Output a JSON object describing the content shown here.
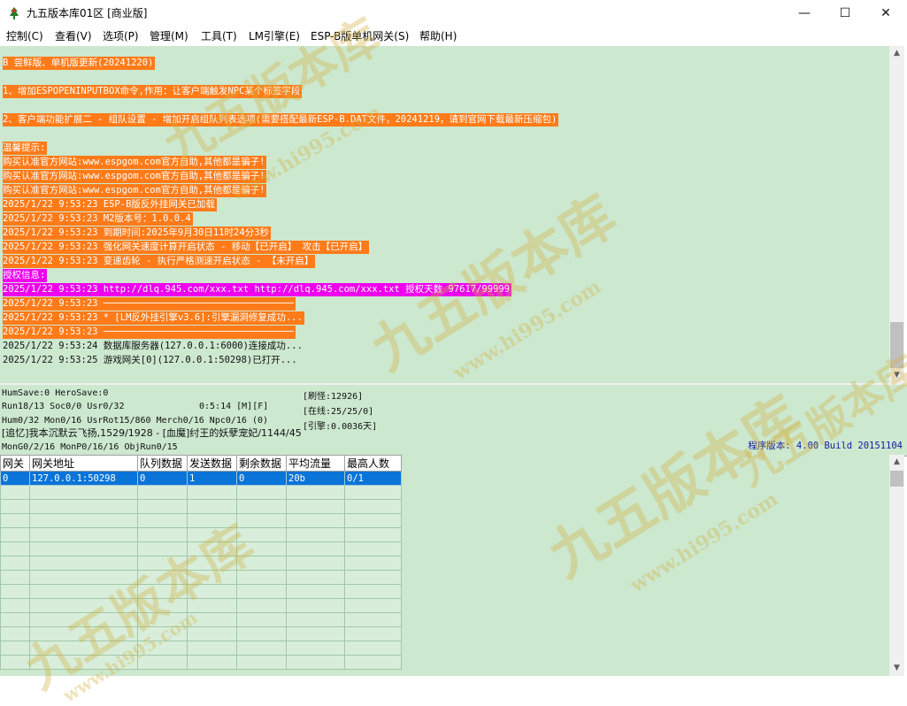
{
  "window": {
    "title": "九五版本库01区 [商业版]",
    "minimize": "—",
    "maximize": "☐",
    "close": "✕"
  },
  "menu": [
    "控制(C)",
    "查看(V)",
    "选项(P)",
    "管理(M)",
    "工具(T)",
    "LM引擎(E)",
    "ESP-B版单机网关(S)",
    "帮助(H)"
  ],
  "log": [
    {
      "text": "B 尝鲜版、单机版更新(20241220)",
      "style": "orange"
    },
    {
      "text": "1、增加ESPOPENINPUTBOX命令,作用：让客户端触发NPC某个标签字段",
      "style": "orange"
    },
    {
      "text": "2、客户端功能扩展二 - 组队设置 - 增加开启组队列表选项(需要搭配最新ESP-B.DAT文件，20241219，请到官网下载最新压缩包)",
      "style": "orange"
    },
    {
      "text": "温馨提示:",
      "style": "orange"
    },
    {
      "text": "购买认准官方网站:www.espgom.com官方自助,其他都是骗子!",
      "style": "orange"
    },
    {
      "text": "购买认准官方网站:www.espgom.com官方自助,其他都是骗子!",
      "style": "orange"
    },
    {
      "text": "购买认准官方网站:www.espgom.com官方自助,其他都是骗子!",
      "style": "orange"
    },
    {
      "text": "2025/1/22 9:53:23 ESP-B版反外挂网关已加载",
      "style": "orange"
    },
    {
      "text": "2025/1/22 9:53:23 M2版本号：1.0.0.4",
      "style": "orange"
    },
    {
      "text": "2025/1/22 9:53:23 到期时间:2025年9月30日11时24分3秒",
      "style": "orange"
    },
    {
      "text": "2025/1/22 9:53:23 强化网关速度计算开启状态 - 移动【已开启】 攻击【已开启】",
      "style": "orange"
    },
    {
      "text": "2025/1/22 9:53:23 变速齿轮 - 执行严格测速开启状态 - 【未开启】",
      "style": "orange"
    },
    {
      "text": "授权信息:",
      "style": "magenta"
    },
    {
      "text": "2025/1/22 9:53:23 http://dlq.945.com/xxx.txt http://dlq.945.com/xxx.txt 授权天数 97617/99999",
      "style": "magenta"
    },
    {
      "text": "2025/1/22 9:53:23 ──────────────────────────────────",
      "style": "orange"
    },
    {
      "text": "2025/1/22 9:53:23 * [LM反外挂引擎v3.6]:引擎漏洞修复成功...",
      "style": "orange"
    },
    {
      "text": "2025/1/22 9:53:23 ──────────────────────────────────",
      "style": "orange"
    },
    {
      "text": "2025/1/22 9:53:24 数据库服务器(127.0.0.1:6000)连接成功...",
      "style": "plain"
    },
    {
      "text": "2025/1/22 9:53:25 游戏网关[0](127.0.0.1:50298)已打开...",
      "style": "plain"
    }
  ],
  "status": {
    "humsave": "HumSave:0 HeroSave:0",
    "run": "Run18/13 Soc0/0 Usr0/32",
    "time": "0:5:14 [M][F]",
    "hum": "Hum0/32 Mon0/16 UsrRot15/860 Merch0/16 Npc0/16 (0)",
    "recall": "[追忆]我本沉默云飞扬,1529/1928 - [血魔]纣王的妖孽宠妃/1144/45",
    "mongo": "MonG0/2/16 MonP0/16/16 ObjRun0/15",
    "refresh": "[刷怪:12926]",
    "online": "[在线:25/25/0]",
    "engine": "[引擎:0.0036天]",
    "version": "程序版本: 4.00 Build 20151104"
  },
  "grid": {
    "columns": [
      "网关",
      "网关地址",
      "队列数据",
      "发送数据",
      "剩余数据",
      "平均流量",
      "最高人数"
    ],
    "rows": [
      [
        "0",
        "127.0.0.1:50298",
        "0",
        "1",
        "0",
        "20b",
        "0/1"
      ]
    ],
    "empty_rows": 13
  },
  "watermark": {
    "text": "九五版本库",
    "url": "www.hi995.com"
  },
  "colors": {
    "log_bg": "#cce8cf",
    "highlight_orange": "#ff7b19",
    "highlight_magenta": "#ee00ee",
    "selection": "#0a74d8"
  }
}
